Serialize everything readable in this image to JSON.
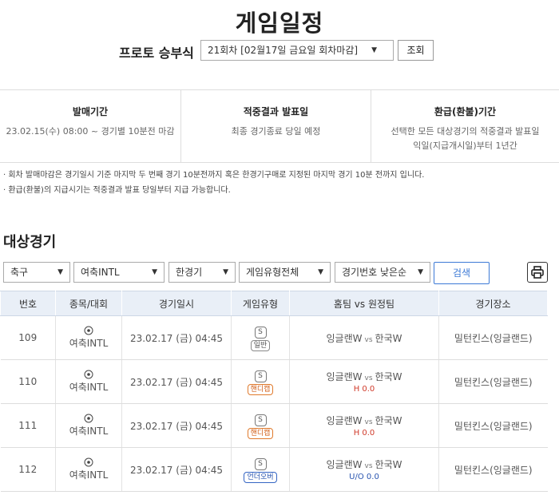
{
  "header": {
    "title": "게임일정"
  },
  "round": {
    "label": "프로토 승부식",
    "selected": "21회차 [02월17일 금요일 회차마감]",
    "query_button": "조회"
  },
  "info": [
    {
      "head": "발매기간",
      "body": "23.02.15(수) 08:00 ~ 경기별 10분전 마감"
    },
    {
      "head": "적중결과 발표일",
      "body": "최종 경기종료 당일 예정"
    },
    {
      "head": "환급(환불)기간",
      "body": "선택한 모든 대상경기의 적중결과 발표일",
      "body2": "익일(지급개시일)부터 1년간"
    }
  ],
  "notes": [
    "· 회차 발매마감은 경기일시 기준 마지막 두 번째 경기 10분전까지 혹은 한경기구매로 지정된 마지막 경기 10분 전까지 입니다.",
    "· 환급(환불)의 지급시기는 적중결과 발표 당일부터 지급 가능합니다."
  ],
  "section": {
    "title": "대상경기"
  },
  "filters": {
    "sport": "축구",
    "league": "여축INTL",
    "single": "한경기",
    "type": "게임유형전체",
    "sort": "경기번호 낮은순",
    "search_button": "검색"
  },
  "table": {
    "headers": [
      "번호",
      "종목/대회",
      "경기일시",
      "게임유형",
      "홈팀 vs 원정팀",
      "경기장소"
    ],
    "vs_label": "vs",
    "rows": [
      {
        "no": "109",
        "league": "여축INTL",
        "datetime": "23.02.17 (금) 04:45",
        "type_code": "S",
        "type": "일반",
        "home": "잉글랜W",
        "away": "한국W",
        "sub": "",
        "venue": "밀턴킨스(잉글랜드)"
      },
      {
        "no": "110",
        "league": "여축INTL",
        "datetime": "23.02.17 (금) 04:45",
        "type_code": "S",
        "type": "핸디캡",
        "home": "잉글랜W",
        "away": "한국W",
        "sub": "H 0.0",
        "venue": "밀턴킨스(잉글랜드)"
      },
      {
        "no": "111",
        "league": "여축INTL",
        "datetime": "23.02.17 (금) 04:45",
        "type_code": "S",
        "type": "핸디캡",
        "home": "잉글랜W",
        "away": "한국W",
        "sub": "H 0.0",
        "venue": "밀턴킨스(잉글랜드)"
      },
      {
        "no": "112",
        "league": "여축INTL",
        "datetime": "23.02.17 (금) 04:45",
        "type_code": "S",
        "type": "언더오버",
        "home": "잉글랜W",
        "away": "한국W",
        "sub": "U/O 0.0",
        "venue": "밀턴킨스(잉글랜드)"
      }
    ]
  },
  "colors": {
    "header_bg": "#e9eff7",
    "accent_blue": "#3d7ad6",
    "handicap": "#d2601a",
    "underover": "#2a55b0"
  },
  "icons": {
    "ball": "soccer-ball-icon",
    "print": "printer-icon",
    "dropdown": "chevron-down-icon"
  }
}
